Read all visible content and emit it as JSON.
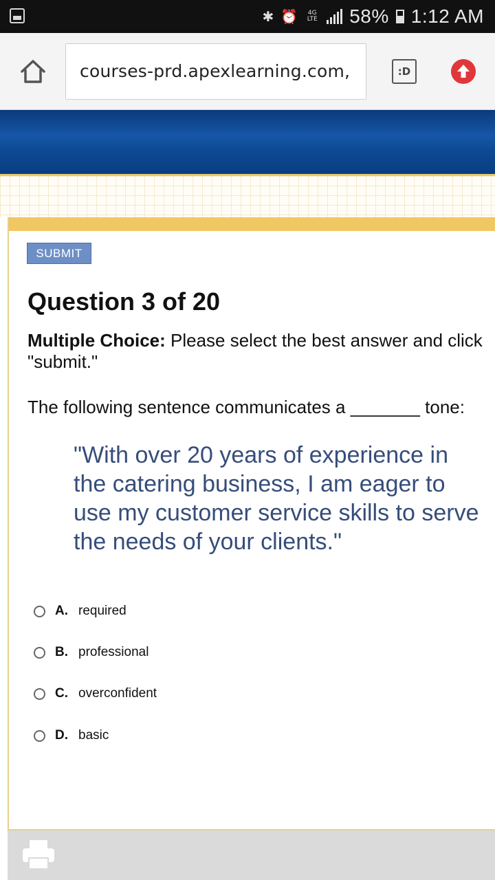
{
  "status_bar": {
    "network_label": "4G LTE",
    "battery": "58%",
    "time": "1:12 AM"
  },
  "browser": {
    "url": "courses-prd.apexlearning.com,",
    "tab_button_label": ":D"
  },
  "quiz": {
    "submit_label": "SUBMIT",
    "question_title": "Question 3 of 20",
    "type_label": "Multiple Choice:",
    "instructions": " Please select the best answer and click \"submit.\"",
    "prompt": "The following sentence communicates a _______ tone:",
    "quote": "\"With over 20 years of experience in the catering business, I am eager to use my customer service skills to serve the needs of your clients.\"",
    "choices": [
      {
        "letter": "A.",
        "text": "required"
      },
      {
        "letter": "B.",
        "text": "professional"
      },
      {
        "letter": "C.",
        "text": "overconfident"
      },
      {
        "letter": "D.",
        "text": "basic"
      }
    ]
  },
  "colors": {
    "accent_gold": "#f1c764",
    "banner_blue": "#1656a8",
    "quote_text": "#364d7a",
    "submit_bg": "#6d8fc6"
  },
  "icons": [
    "gallery-icon",
    "bluetooth-icon",
    "alarm-icon",
    "signal-icon",
    "battery-icon",
    "home-icon",
    "tab-switcher-icon",
    "upload-icon",
    "print-icon"
  ]
}
